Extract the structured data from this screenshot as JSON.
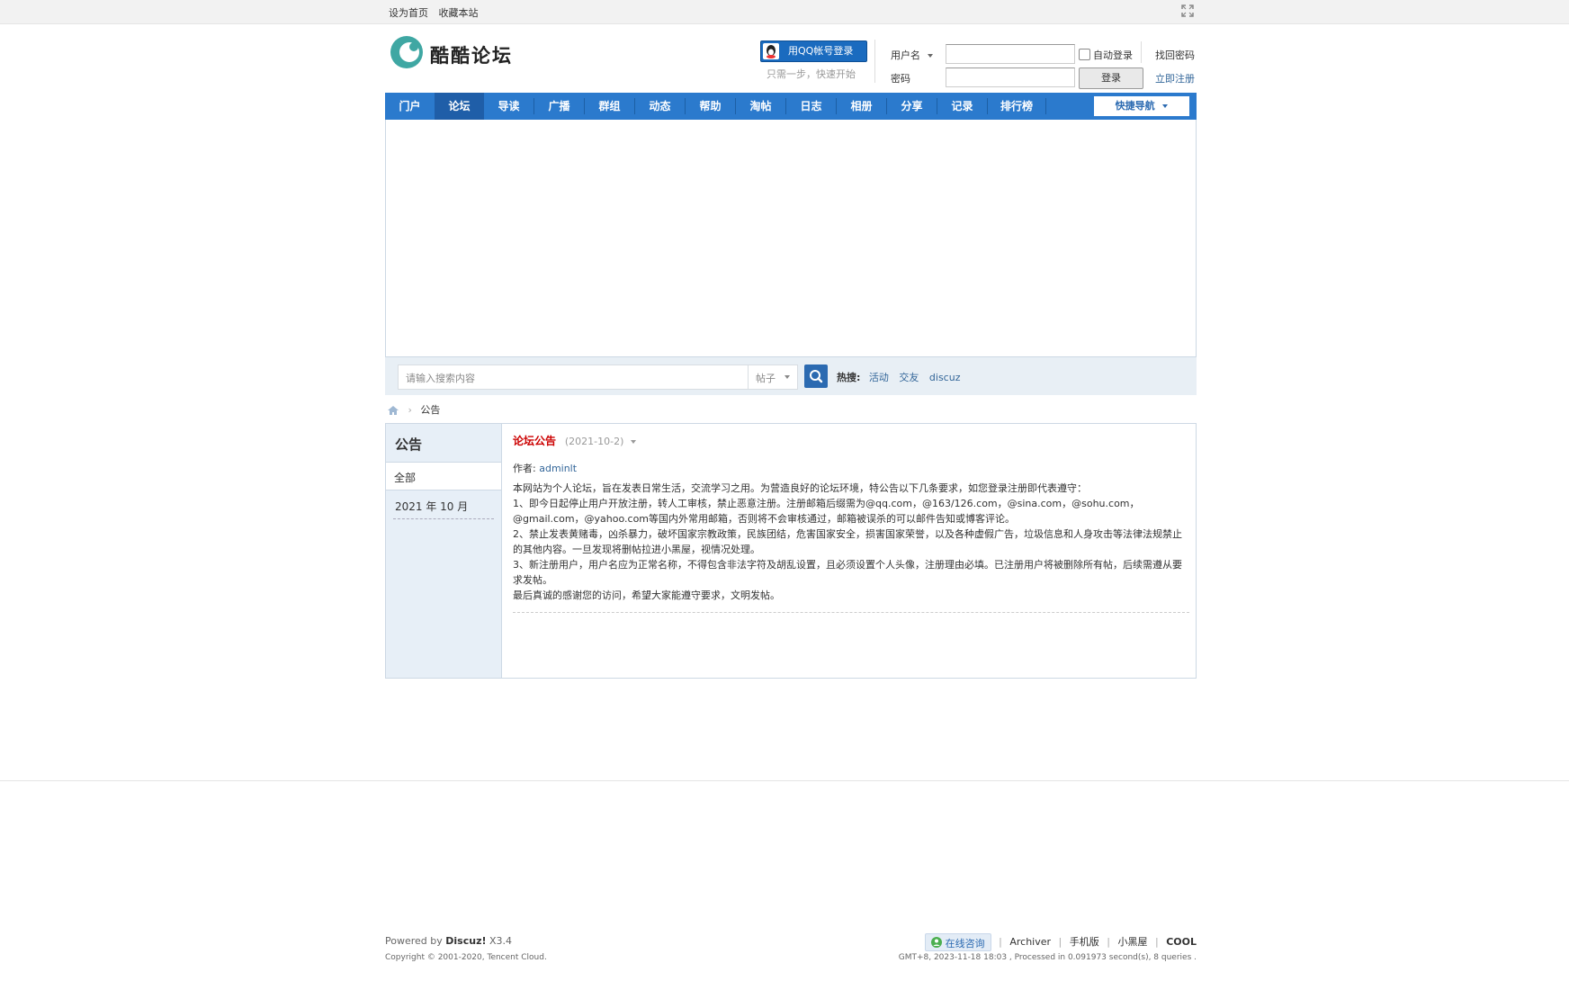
{
  "topbar": {
    "set_home": "设为首页",
    "bookmark": "收藏本站"
  },
  "site": {
    "logo_text": "酷酷论坛"
  },
  "login": {
    "qq_label": "用QQ帐号登录",
    "qq_hint": "只需一步，快速开始",
    "username_label": "用户名",
    "password_label": "密码",
    "auto_login": "自动登录",
    "login_button": "登录",
    "find_password": "找回密码",
    "register": "立即注册"
  },
  "nav": {
    "items": [
      "门户",
      "论坛",
      "导读",
      "广播",
      "群组",
      "动态",
      "帮助",
      "淘帖",
      "日志",
      "相册",
      "分享",
      "记录",
      "排行榜"
    ],
    "active_index": 1,
    "quick_nav": "快捷导航"
  },
  "search": {
    "placeholder": "请输入搜索内容",
    "type": "帖子",
    "hot_label": "热搜:",
    "hot_keywords": [
      "活动",
      "交友",
      "discuz"
    ]
  },
  "breadcrumb": {
    "current": "公告"
  },
  "sidebar": {
    "title": "公告",
    "all": "全部",
    "month": "2021 年 10 月"
  },
  "announcement": {
    "title": "论坛公告",
    "date": "(2021-10-2)",
    "author_label": "作者:",
    "author": "adminlt",
    "lines": [
      "本网站为个人论坛，旨在发表日常生活，交流学习之用。为营造良好的论坛环境，特公告以下几条要求，如您登录注册即代表遵守：",
      "1、即今日起停止用户开放注册，转人工审核，禁止恶意注册。注册邮箱后缀需为@qq.com，@163/126.com，@sina.com，@sohu.com，@gmail.com，@yahoo.com等国内外常用邮箱，否则将不会审核通过，邮箱被误杀的可以邮件告知或博客评论。",
      "2、禁止发表黄赌毒，凶杀暴力，破坏国家宗教政策，民族团结，危害国家安全，损害国家荣誉，以及各种虚假广告，垃圾信息和人身攻击等法律法规禁止的其他内容。一旦发现将删帖拉进小黑屋，视情况处理。",
      "3、新注册用户，用户名应为正常名称，不得包含非法字符及胡乱设置，且必须设置个人头像，注册理由必填。已注册用户将被删除所有帖，后续需遵从要求发帖。",
      "最后真诚的感谢您的访问，希望大家能遵守要求，文明发帖。"
    ]
  },
  "footer": {
    "powered_prefix": "Powered by",
    "powered_brand": "Discuz!",
    "powered_version": "X3.4",
    "copyright": "Copyright © 2001-2020, Tencent Cloud.",
    "online_consult": "在线咨询",
    "links": [
      "Archiver",
      "手机版",
      "小黑屋"
    ],
    "brand": "COOL",
    "info": "GMT+8, 2023-11-18 18:03 , Processed in 0.091973 second(s), 8 queries ."
  },
  "colors": {
    "nav_bg": "#2b7acd",
    "nav_active": "#1f5ea8",
    "title_red": "#cc0000",
    "link_blue": "#336699"
  }
}
